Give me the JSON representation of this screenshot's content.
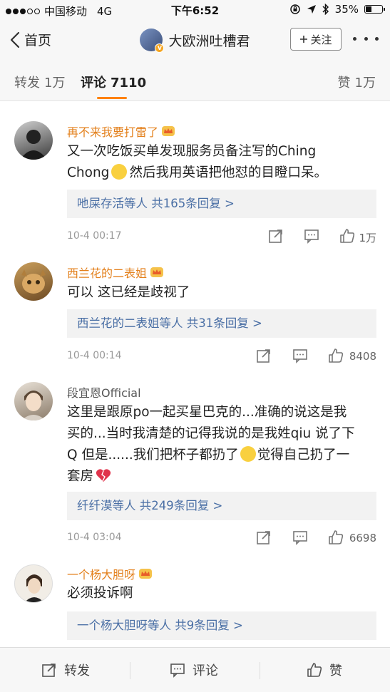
{
  "status": {
    "carrier": "中国移动",
    "network": "4G",
    "time": "下午6:52",
    "battery": "35%"
  },
  "nav": {
    "back_label": "首页",
    "title": "大欧洲吐槽君",
    "follow_label": "关注"
  },
  "tabs": [
    {
      "label": "转发",
      "count": "1万"
    },
    {
      "label": "评论",
      "count": "7110"
    },
    {
      "label": "赞",
      "count": "1万"
    }
  ],
  "comments": [
    {
      "name": "再不来我要打雷了",
      "text_1": "又一次吃饭买单发现服务员备注写的Ching",
      "text_2a": "Chong",
      "text_2b": "然后我用英语把他怼的目瞪口呆。",
      "reply_summary": "吔屎存活等人  共165条回复 >",
      "time": "10-4 00:17",
      "likes": "1万"
    },
    {
      "name": "西兰花的二表姐",
      "text": "可以 这已经是歧视了",
      "reply_summary": "西兰花的二表姐等人  共31条回复 >",
      "time": "10-4 00:14",
      "likes": "8408"
    },
    {
      "name": "段宜恩Official",
      "text_1": "这里是跟原po一起买星巴克的...准确的说这是我",
      "text_2": "买的...当时我清楚的记得我说的是我姓qiu 说了下",
      "text_3a": "Q 但是......我们把杯子都扔了",
      "text_3b": "觉得自己扔了一",
      "text_4": "套房",
      "reply_summary": "纤纤漠等人  共249条回复 >",
      "time": "10-4 03:04",
      "likes": "6698"
    },
    {
      "name": "一个杨大胆呀",
      "text": "必须投诉啊",
      "reply_summary": "一个杨大胆呀等人  共9条回复 >"
    }
  ],
  "bottom": {
    "repost_label": "转发",
    "comment_label": "评论",
    "like_label": "赞"
  },
  "colors": {
    "accent": "#ff8200",
    "name_orange": "#e3801c",
    "link_blue": "#4a6fa5"
  },
  "icons": [
    "back-chevron-icon",
    "verified-badge-icon",
    "plus-icon",
    "more-icon",
    "crown-icon",
    "smile-emoji-icon",
    "crying-emoji-icon",
    "broken-heart-icon",
    "repost-icon",
    "comment-icon",
    "like-icon"
  ]
}
